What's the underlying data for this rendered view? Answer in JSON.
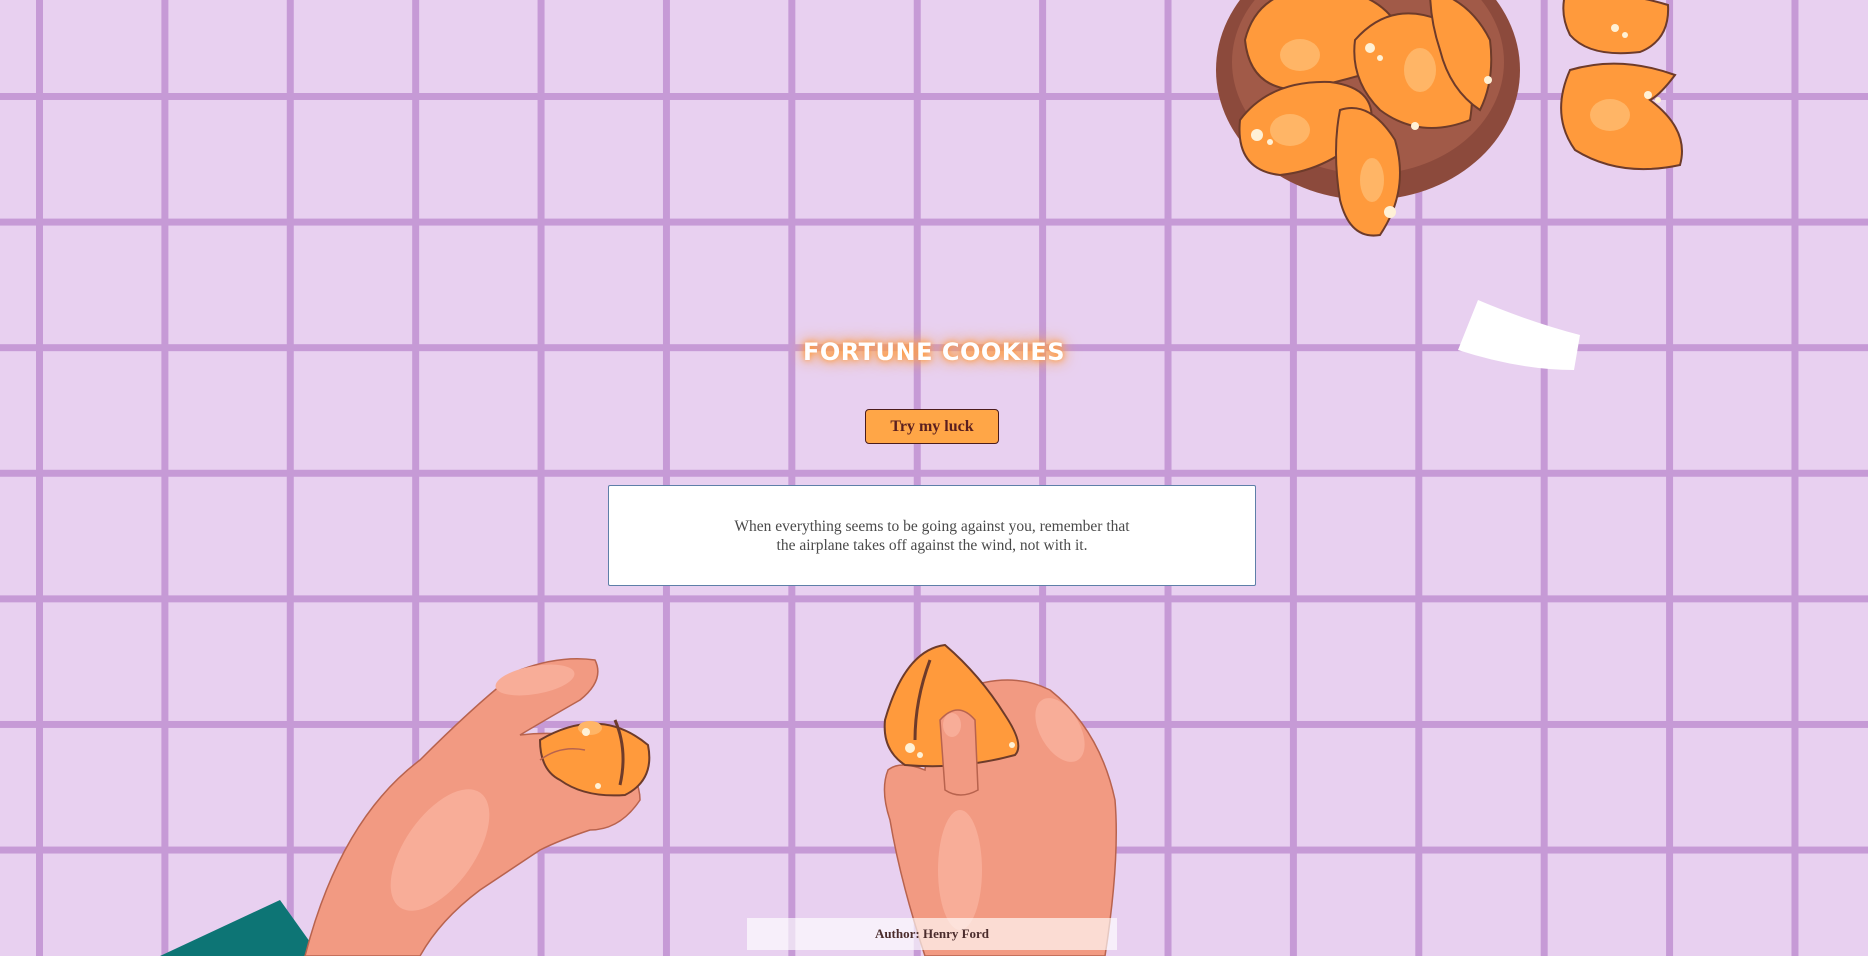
{
  "title": "FORTUNE COOKIES",
  "button": {
    "label": "Try my luck"
  },
  "fortune": {
    "text": "When everything seems to be going against you, remember that the airplane takes off against the wind, not with it."
  },
  "author": {
    "prefix": "Author: ",
    "name": "Henry Ford"
  },
  "illustration": {
    "icons": [
      "cookie-bowl-illustration",
      "fortune-cookie-icon",
      "fortune-paper-slip",
      "left-hand-illustration",
      "right-hand-illustration"
    ]
  },
  "colors": {
    "background": "#e8d0f0",
    "grid_lines": "#c69ad6",
    "button": "#ffa647",
    "cookie": "#ff9a3c",
    "skin": "#f29a82"
  }
}
